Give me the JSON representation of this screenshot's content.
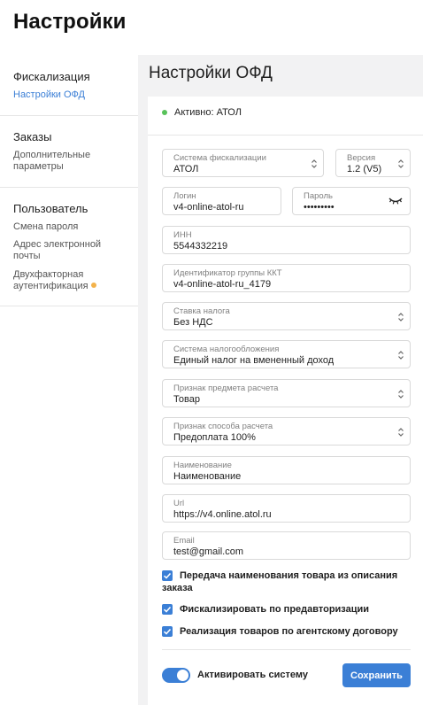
{
  "page": {
    "title": "Настройки"
  },
  "sidebar": {
    "sections": [
      {
        "heading": "Фискализация",
        "items": [
          {
            "label": "Настройки ОФД",
            "active": true
          }
        ]
      },
      {
        "heading": "Заказы",
        "items": [
          {
            "label": "Дополнительные параметры"
          }
        ]
      },
      {
        "heading": "Пользователь",
        "items": [
          {
            "label": "Смена пароля"
          },
          {
            "label": "Адрес электронной почты"
          },
          {
            "label": "Двухфакторная аутентификация",
            "badge": "orange-dot"
          }
        ]
      }
    ]
  },
  "main": {
    "title": "Настройки ОФД",
    "status": {
      "text": "Активно: АТОЛ",
      "color": "#58c25a"
    },
    "fields": {
      "fiscal_system": {
        "label": "Система фискализации",
        "value": "АТОЛ"
      },
      "version": {
        "label": "Версия",
        "value": "1.2 (V5)"
      },
      "login": {
        "label": "Логин",
        "value": "v4-online-atol-ru"
      },
      "password": {
        "label": "Пароль",
        "value": "•••••••••"
      },
      "inn": {
        "label": "ИНН",
        "value": "5544332219"
      },
      "kkt_group": {
        "label": "Идентификатор группы ККТ",
        "value": "v4-online-atol-ru_4179"
      },
      "tax_rate": {
        "label": "Ставка налога",
        "value": "Без НДС"
      },
      "tax_system": {
        "label": "Система налогообложения",
        "value": "Единый налог на вмененный доход"
      },
      "item_type": {
        "label": "Признак предмета расчета",
        "value": "Товар"
      },
      "payment_method": {
        "label": "Признак способа расчета",
        "value": "Предоплата 100%"
      },
      "name": {
        "label": "Наименование",
        "value": "Наименование"
      },
      "url": {
        "label": "Url",
        "value": "https://v4.online.atol.ru"
      },
      "email": {
        "label": "Email",
        "value": "test@gmail.com"
      }
    },
    "checkboxes": {
      "pass_name": {
        "label": "Передача наименования товара из описания заказа",
        "checked": true
      },
      "preauth": {
        "label": "Фискализировать по предавторизации",
        "checked": true
      },
      "agency": {
        "label": "Реализация товаров по агентскому договору",
        "checked": true
      }
    },
    "footer": {
      "toggle_label": "Активировать систему",
      "toggle_on": true,
      "save_label": "Сохранить"
    }
  },
  "colors": {
    "accent": "#3b7fd6",
    "status_green": "#58c25a",
    "badge_orange": "#f3b24a",
    "background": "#f2f2f3"
  }
}
